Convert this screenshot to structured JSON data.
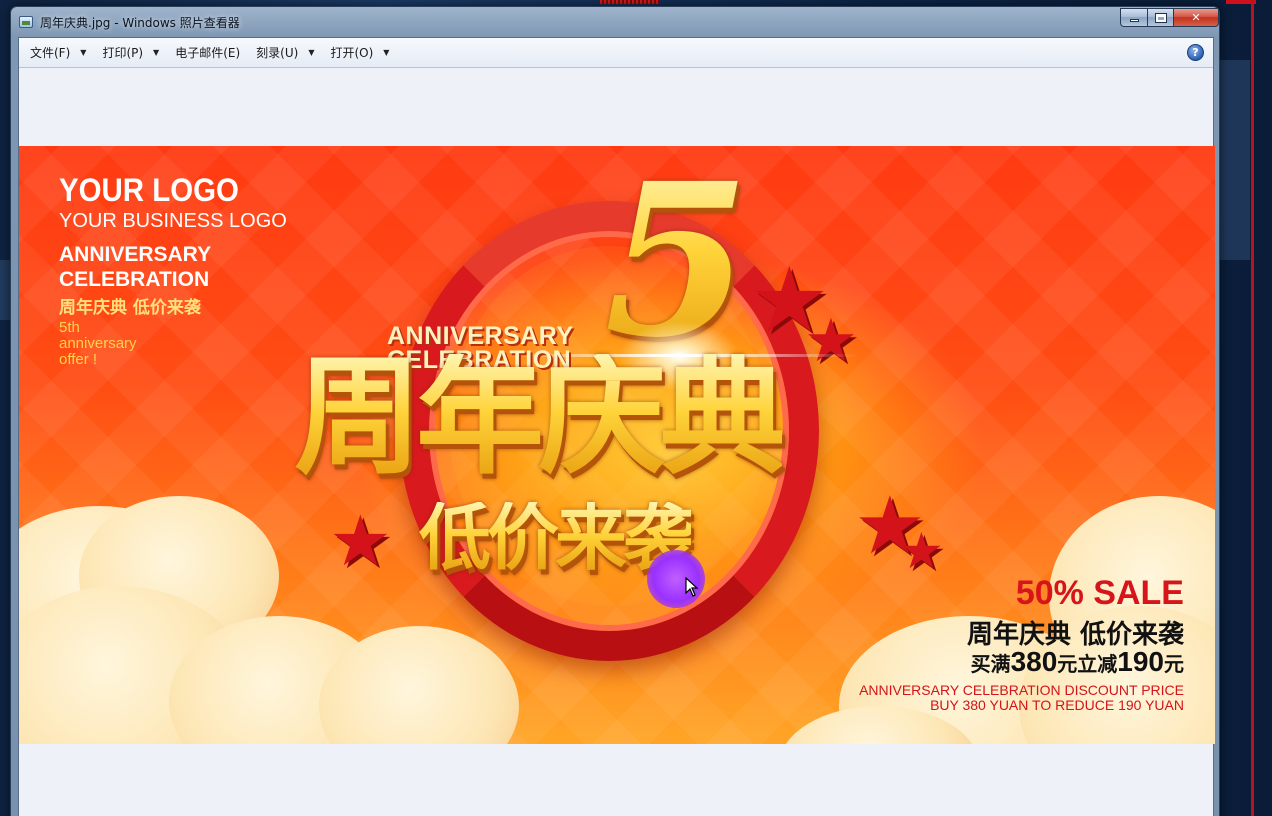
{
  "window": {
    "title": "周年庆典.jpg - Windows 照片查看器",
    "caption_buttons": {
      "minimize": "minimize",
      "maximize": "maximize",
      "close": "✕"
    }
  },
  "menu": {
    "file": "文件(F)",
    "print": "打印(P)",
    "email": "电子邮件(E)",
    "burn": "刻录(U)",
    "open": "打开(O)",
    "help": "?"
  },
  "photo": {
    "logo_main": "YOUR LOGO",
    "logo_sub": "YOUR BUSINESS LOGO",
    "left_ann_1": "ANNIVERSARY",
    "left_ann_2": "CELEBRATION",
    "left_cn": "周年庆典 低价来袭",
    "left_offer_1": "5th",
    "left_offer_2": "anniversary",
    "left_offer_3": "offer !",
    "big_number": "5",
    "center_ann_1": "ANNIVERSARY",
    "center_ann_2": "CELEBRATION",
    "main_cn": "周年庆典",
    "sub_cn": "低价来袭",
    "sale": "50% SALE",
    "promo_cn": "周年庆典 低价来袭",
    "promo_buy": "买满",
    "promo_380": "380",
    "promo_yuan1": "元立减",
    "promo_190": "190",
    "promo_yuan2": "元",
    "promo_en_1": "ANNIVERSARY CELEBRATION DISCOUNT PRICE",
    "promo_en_2": "BUY 380 YUAN TO REDUCE 190 YUAN"
  },
  "colors": {
    "accent_red": "#d7141a",
    "gold": "#ffd84a",
    "banner_orange": "#ff4d14"
  }
}
